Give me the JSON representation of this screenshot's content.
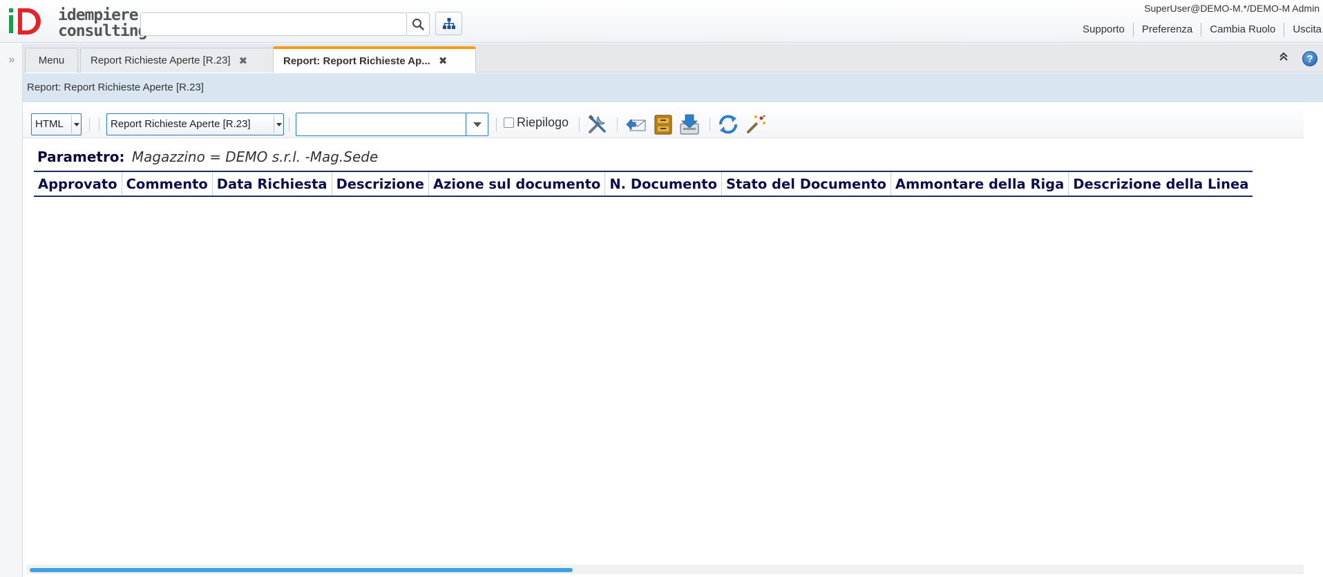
{
  "brand": {
    "line1": "idempiere",
    "line2": "consulting",
    "colors": {
      "green": "#12a14b",
      "red": "#e2252b"
    }
  },
  "header": {
    "search": {
      "value": "",
      "placeholder": ""
    },
    "search_icon": "search-icon",
    "tree_icon": "sitemap-icon",
    "user": "SuperUser@DEMO-M.*/DEMO-M Admin",
    "links": [
      "Supporto",
      "Preferenza",
      "Cambia Ruolo",
      "Uscita"
    ]
  },
  "west": {
    "expand_icon": "double-chevron-right-icon",
    "glyph": "»"
  },
  "tabs": {
    "menu": "Menu",
    "items": [
      {
        "label": "Report Richieste Aperte [R.23]",
        "close": "✖"
      },
      {
        "label": "Report: Report Richieste Ap...",
        "close": "✖",
        "active": true
      }
    ],
    "collapse_glyph": "⌃",
    "help_glyph": "?",
    "active_accent": "#f59b1c"
  },
  "title": "Report: Report Richieste Aperte [R.23]",
  "toolbar": {
    "format": "HTML",
    "report_view": "Report Richieste Aperte [R.23]",
    "print_format": {
      "value": ""
    },
    "summary_label": "Riepilogo",
    "summary_checked": false,
    "icons": [
      "customize-icon",
      "send-mail-icon",
      "archive-icon",
      "export-icon",
      "refresh-icon",
      "wizard-icon"
    ]
  },
  "report": {
    "param_label": "Parametro:",
    "param_value": "Magazzino = DEMO s.r.l. -Mag.Sede",
    "columns": [
      "Approvato",
      "Commento",
      "Data Richiesta",
      "Descrizione",
      "Azione sul documento",
      "N. Documento",
      "Stato del Documento",
      "Ammontare della Riga",
      "Descrizione della Linea"
    ],
    "header_color": "#0a0f4a"
  },
  "scrollbar": {
    "thumb_color": "#3da3e0"
  }
}
